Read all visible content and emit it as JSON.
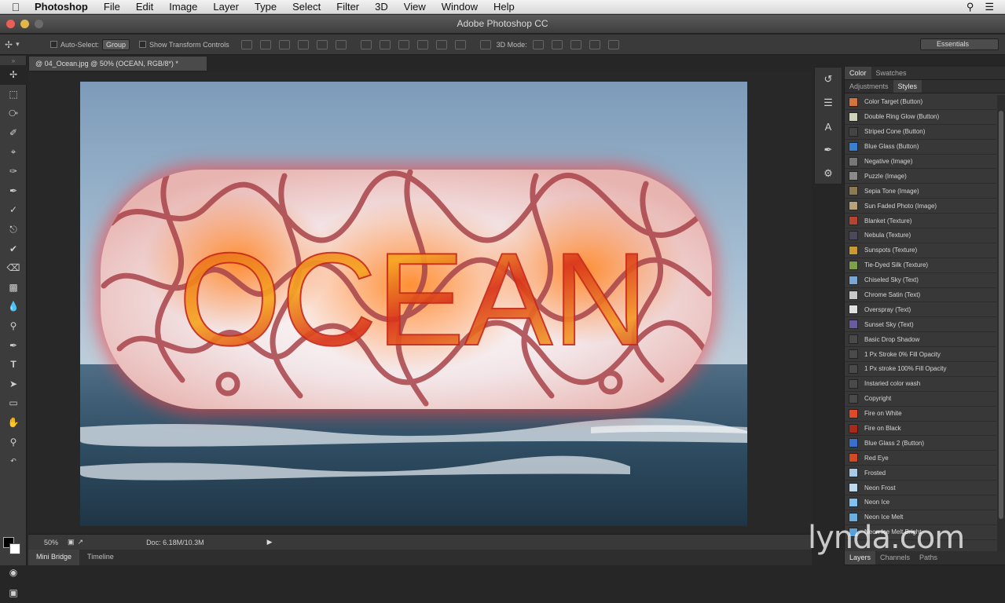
{
  "menubar": {
    "app": "Photoshop",
    "items": [
      "File",
      "Edit",
      "Image",
      "Layer",
      "Type",
      "Select",
      "Filter",
      "3D",
      "View",
      "Window",
      "Help"
    ]
  },
  "window": {
    "title": "Adobe Photoshop CC"
  },
  "options": {
    "auto_select_label": "Auto-Select:",
    "auto_select_value": "Group",
    "transform_label": "Show Transform Controls",
    "mode_label": "3D Mode:",
    "workspace": "Essentials"
  },
  "document": {
    "tab_title": "@ 04_Ocean.jpg @ 50% (OCEAN, RGB/8*) *",
    "text_layer": "OCEAN",
    "zoom": "50%",
    "doc_info": "Doc: 6.18M/10.3M"
  },
  "bottom_tabs": [
    "Mini Bridge",
    "Timeline"
  ],
  "panels": {
    "top_tabs": [
      "Color",
      "Swatches"
    ],
    "mid_tabs": [
      "Adjustments",
      "Styles"
    ],
    "bottom_tabs": [
      "Layers",
      "Channels",
      "Paths"
    ]
  },
  "styles": [
    {
      "label": "Color Target (Button)",
      "color": "#d4733b"
    },
    {
      "label": "Double Ring Glow (Button)",
      "color": "#cfd4b8"
    },
    {
      "label": "Striped Cone (Button)",
      "color": "#444444"
    },
    {
      "label": "Blue Glass (Button)",
      "color": "#3a7fd0"
    },
    {
      "label": "Negative (Image)",
      "color": "#777777"
    },
    {
      "label": "Puzzle (Image)",
      "color": "#8a8a8a"
    },
    {
      "label": "Sepia Tone (Image)",
      "color": "#8c7a55"
    },
    {
      "label": "Sun Faded Photo (Image)",
      "color": "#b7a27a"
    },
    {
      "label": "Blanket (Texture)",
      "color": "#b5452f"
    },
    {
      "label": "Nebula (Texture)",
      "color": "#4a4a5a"
    },
    {
      "label": "Sunspots (Texture)",
      "color": "#c99a2e"
    },
    {
      "label": "Tie-Dyed Silk (Texture)",
      "color": "#7fa04a"
    },
    {
      "label": "Chiseled Sky (Text)",
      "color": "#7aa6d6"
    },
    {
      "label": "Chrome Satin (Text)",
      "color": "#c9c9c9"
    },
    {
      "label": "Overspray (Text)",
      "color": "#e0e0e0"
    },
    {
      "label": "Sunset Sky (Text)",
      "color": "#6a5aa0"
    },
    {
      "label": "Basic Drop Shadow",
      "color": "#4a4a4a"
    },
    {
      "label": "1 Px Stroke 0% Fill Opacity",
      "color": "#4a4a4a"
    },
    {
      "label": "1 Px stroke 100% Fill Opacity",
      "color": "#4a4a4a"
    },
    {
      "label": "Instaried color wash",
      "color": "#4a4a4a"
    },
    {
      "label": "Copyright",
      "color": "#4a4a4a"
    },
    {
      "label": "Fire on White",
      "color": "#e04a2a"
    },
    {
      "label": "Fire on Black",
      "color": "#a82a1a"
    },
    {
      "label": "Blue Glass 2 (Button)",
      "color": "#3a6fd0"
    },
    {
      "label": "Red Eye",
      "color": "#d24a22"
    },
    {
      "label": "Frosted",
      "color": "#aac8e8"
    },
    {
      "label": "Neon Frost",
      "color": "#bcd9f0"
    },
    {
      "label": "Neon Ice",
      "color": "#7fc2ef"
    },
    {
      "label": "Neon Ice Melt",
      "color": "#6aaee0"
    },
    {
      "label": "Neon Ice Melt Bright",
      "color": "#5aa0d8"
    }
  ],
  "watermark": "lynda.com"
}
